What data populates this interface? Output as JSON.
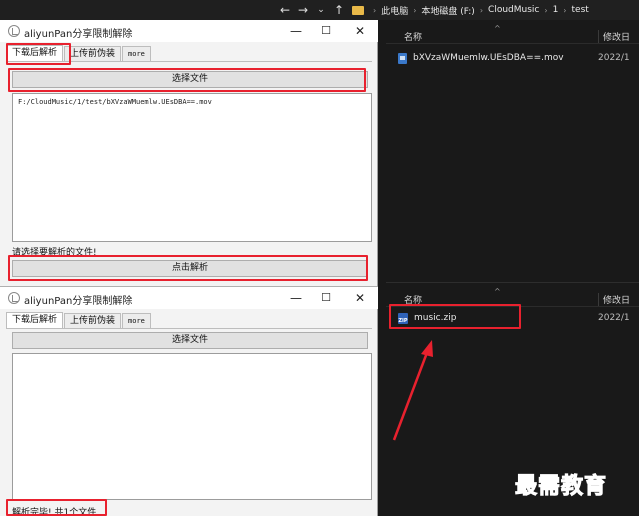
{
  "explorer": {
    "nav": {
      "back": "←",
      "forward": "→",
      "dropdown": "⌄",
      "up": "↑"
    },
    "breadcrumbs": [
      "此电脑",
      "本地磁盘 (F:)",
      "CloudMusic",
      "1",
      "test"
    ],
    "crumb_sep": "›",
    "top_panel": {
      "col_name": "名称",
      "col_date": "修改日",
      "sort_caret": "^",
      "files": [
        {
          "name": "bXVzaWMuemlw.UEsDBA==.mov",
          "date": "2022/1"
        }
      ]
    },
    "bottom_panel": {
      "col_name": "名称",
      "col_date": "修改日",
      "sort_caret": "^",
      "files": [
        {
          "name": "music.zip",
          "date": "2022/1",
          "icon_text": "ZIP"
        }
      ]
    }
  },
  "app_before": {
    "title": "aliyunPan分享限制解除",
    "controls": {
      "minimize": "—",
      "maximize": "☐",
      "close": "✕"
    },
    "tabs": [
      "下载后解析",
      "上传前伪装",
      "more"
    ],
    "choose_button": "选择文件",
    "textarea_value": "F:/CloudMusic/1/test/bXVzaWMuemlw.UEsDBA==.mov",
    "status": "请选择要解析的文件!",
    "parse_button": "点击解析"
  },
  "app_after": {
    "title": "aliyunPan分享限制解除",
    "controls": {
      "minimize": "—",
      "maximize": "☐",
      "close": "✕"
    },
    "tabs": [
      "下载后解析",
      "上传前伪装",
      "more"
    ],
    "choose_button": "选择文件",
    "textarea_value": "",
    "status": "解析完毕! 共1个文件"
  },
  "watermark": "最需教育",
  "colors": {
    "highlight": "#e8212e",
    "folder": "#e9b949",
    "watermark": "#1e3d9e"
  }
}
